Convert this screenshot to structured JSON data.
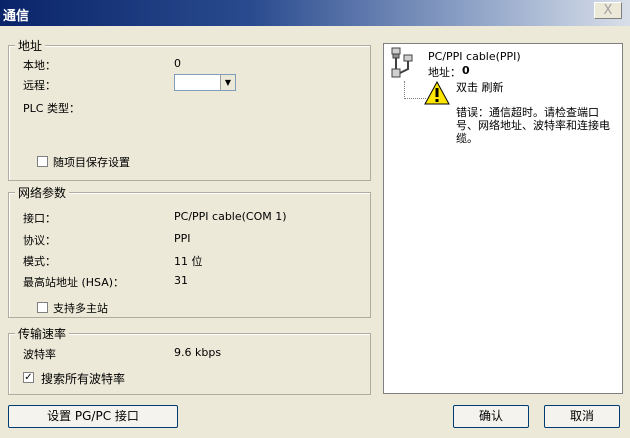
{
  "window": {
    "title": "通信",
    "close_label": "X"
  },
  "address_group": {
    "legend": "地址",
    "local_label": "本地：",
    "local_value": "0",
    "remote_label": "远程：",
    "remote_value": "",
    "plc_type_label": "PLC 类型：",
    "save_checkbox_label": "随项目保存设置"
  },
  "network_group": {
    "legend": "网络参数",
    "interface_label": "接口：",
    "interface_value": "PC/PPI cable(COM 1)",
    "protocol_label": "协议：",
    "protocol_value": "PPI",
    "mode_label": "模式：",
    "mode_value": "11 位",
    "hsa_label": "最高站地址 (HSA)：",
    "hsa_value": "31",
    "multimaster_label": "支持多主站"
  },
  "rate_group": {
    "legend": "传输速率",
    "baud_label": "波特率",
    "baud_value": "9.6 kbps",
    "search_all_label": "搜索所有波特率",
    "search_all_checked": "✓"
  },
  "right_panel": {
    "cable_name": "PC/PPI cable(PPI)",
    "address_label": "地址：",
    "address_value": "0",
    "refresh_label": "双击 刷新",
    "error_text": "错误：通信超时。请检查端口号、网络地址、波特率和连接电缆。"
  },
  "buttons": {
    "setup_pgpc": "设置 PG/PC 接口",
    "ok": "确认",
    "cancel": "取消"
  }
}
